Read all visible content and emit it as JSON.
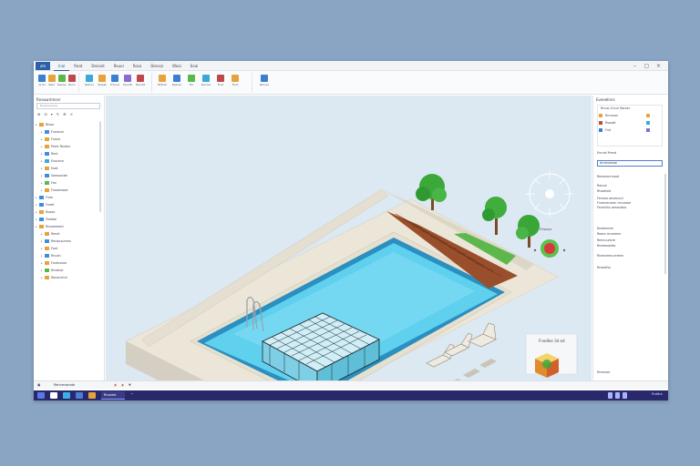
{
  "window": {
    "file_tab": "ute"
  },
  "menu": [
    "Inal",
    "Reat",
    "Denoid",
    "Reuoi",
    "Rosa",
    "Densoi",
    "Weai",
    "Eeai"
  ],
  "ribbon": {
    "buttons": [
      "Arnd",
      "Renr",
      "Reene",
      "Rono",
      "Retonosu",
      "Sweet",
      "Frtnnrest",
      "Preudt",
      "Rennttemer",
      "Rhtinbo",
      "Reensu",
      "Fer",
      "Renouter",
      "Erut",
      "Flort",
      "Rennorty"
    ]
  },
  "left_panel": {
    "title": "Rneuwrimcer",
    "search_placeholder": "Ruesoaoeors",
    "tree": [
      {
        "label": "Rfoce",
        "level": 0,
        "icon": "#e8a23a"
      },
      {
        "label": "Fnessnd",
        "level": 1,
        "icon": "#3a8fd8"
      },
      {
        "label": "Fnane",
        "level": 1,
        "icon": "#e8a23a"
      },
      {
        "label": "Peert Renkor",
        "level": 1,
        "icon": "#e8a23a"
      },
      {
        "label": "Ront",
        "level": 1,
        "icon": "#3a8fd8"
      },
      {
        "label": "Enacece",
        "level": 1,
        "icon": "#3aa8d8"
      },
      {
        "label": "Eaat",
        "level": 1,
        "icon": "#e8a23a"
      },
      {
        "label": "Seessonbe",
        "level": 1,
        "icon": "#3a8fd8"
      },
      {
        "label": "Feo",
        "level": 1,
        "icon": "#5ab84a"
      },
      {
        "label": "Fneoerxoot",
        "level": 1,
        "icon": "#e8a23a"
      },
      {
        "label": "Fnee",
        "level": 0,
        "icon": "#3a8fd8"
      },
      {
        "label": "Fneet",
        "level": 0,
        "icon": "#3a8fd8"
      },
      {
        "label": "Ruaoo",
        "level": 0,
        "icon": "#e8a23a"
      },
      {
        "label": "Feadae",
        "level": 0,
        "icon": "#3a8fd8"
      },
      {
        "label": "Rinseeeeert",
        "level": 0,
        "icon": "#e8a23a"
      },
      {
        "label": "Renet",
        "level": 1,
        "icon": "#e8a23a"
      },
      {
        "label": "Resrprsumon",
        "level": 1,
        "icon": "#3a8fd8"
      },
      {
        "label": "Foot",
        "level": 1,
        "icon": "#e8a23a"
      },
      {
        "label": "Rnuan",
        "level": 1,
        "icon": "#3a8fd8"
      },
      {
        "label": "Foutnosoo",
        "level": 1,
        "icon": "#e8a23a"
      },
      {
        "label": "Rneaioe",
        "level": 1,
        "icon": "#5ab84a"
      },
      {
        "label": "Rouacntnd",
        "level": 1,
        "icon": "#e8a23a"
      }
    ]
  },
  "viewport": {
    "compass_label": "Fnssnur",
    "nav_cube_label": "Fnodlee 3d ed"
  },
  "right_panel": {
    "title": "Eveeelinrs",
    "section1_header": "Rnuw Chnur Reroer",
    "section1_items": [
      "Rnrauan",
      "Rsoubt",
      "Fnd"
    ],
    "section2_header": "Enruel Pnerd",
    "input_value": "Arnenamoe",
    "props": [
      "Reneeonrrsoot",
      "Ranud",
      "Rtooitmd",
      "Fenneo aevenurd",
      "Fneenecoren nmurolar",
      "Fenelnhs aeneudoo",
      "Rneeeoner",
      "Reauc ecueeenr",
      "Rennuurtcie",
      "Rneeaoodes",
      "Rnesneenunreern",
      "Rneedho"
    ],
    "footer": "Rnesnoe"
  },
  "status": {
    "left": "Rehnerwrode"
  },
  "taskbar": {
    "active_app": "Rnoned",
    "clock": "Rntänr"
  }
}
